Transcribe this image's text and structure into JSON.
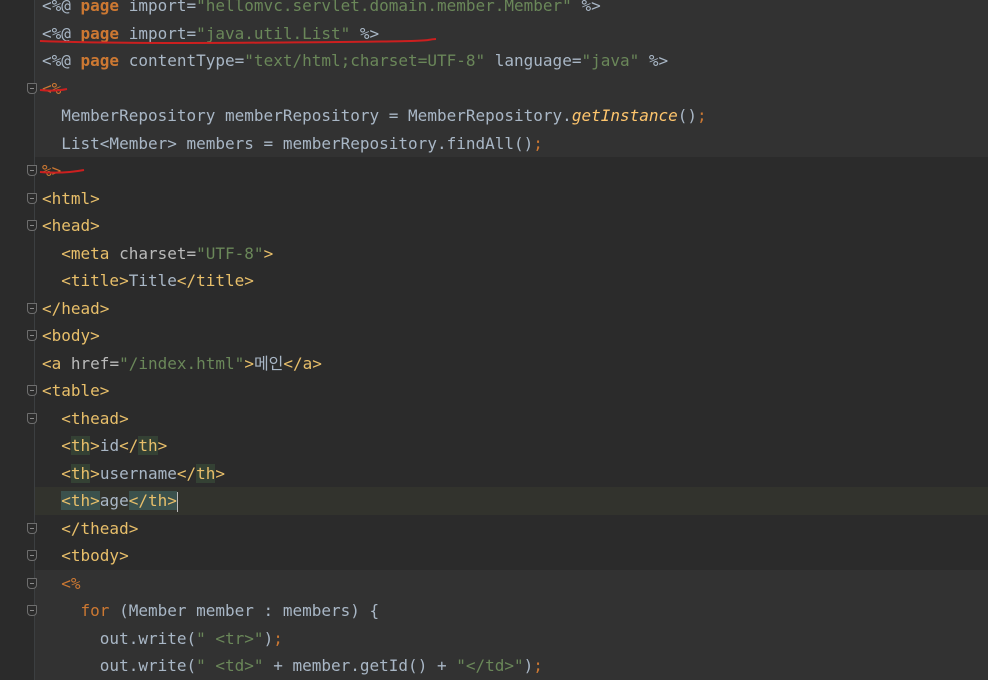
{
  "editor": {
    "lines": [
      {
        "segs": [
          [
            "t-txt",
            "<%@ "
          ],
          [
            "t-dir",
            "page"
          ],
          [
            "t-txt",
            " import="
          ],
          [
            "t-str",
            "\"hellomvc.servlet.domain.member.Member\""
          ],
          [
            "t-txt",
            " %>"
          ]
        ],
        "hl": true,
        "fold": ""
      },
      {
        "segs": [
          [
            "t-txt",
            "<%@ "
          ],
          [
            "t-dir",
            "page"
          ],
          [
            "t-txt",
            " import="
          ],
          [
            "t-str",
            "\"java.util.List\""
          ],
          [
            "t-txt",
            " %>"
          ]
        ],
        "hl": true,
        "fold": ""
      },
      {
        "segs": [
          [
            "t-txt",
            "<%@ "
          ],
          [
            "t-dir",
            "page"
          ],
          [
            "t-txt",
            " contentType="
          ],
          [
            "t-str",
            "\"text/html;charset=UTF-8\""
          ],
          [
            "t-txt",
            " language="
          ],
          [
            "t-str",
            "\"java\""
          ],
          [
            "t-txt",
            " %>"
          ]
        ],
        "hl": true,
        "fold": ""
      },
      {
        "segs": [
          [
            "t-kw",
            "<%"
          ]
        ],
        "hl": true,
        "fold": "start"
      },
      {
        "segs": [
          [
            "t-plain",
            "  MemberRepository memberRepository = MemberRepository."
          ],
          [
            "t-italic",
            "getInstance"
          ],
          [
            "t-plain",
            "()"
          ],
          [
            "t-semi",
            ";"
          ]
        ],
        "hl": true,
        "fold": ""
      },
      {
        "segs": [
          [
            "t-plain",
            "  List<Member> members = memberRepository.findAll()"
          ],
          [
            "t-semi",
            ";"
          ]
        ],
        "hl": true,
        "fold": ""
      },
      {
        "segs": [
          [
            "t-kw",
            "%>"
          ]
        ],
        "hl": false,
        "fold": "end"
      },
      {
        "segs": [
          [
            "t-tag",
            "<html>"
          ]
        ],
        "hl": false,
        "fold": "start"
      },
      {
        "segs": [
          [
            "t-tag",
            "<head>"
          ]
        ],
        "hl": false,
        "fold": "start"
      },
      {
        "segs": [
          [
            "t-txt",
            "  "
          ],
          [
            "t-tag",
            "<meta "
          ],
          [
            "t-attr",
            "charset="
          ],
          [
            "t-str",
            "\"UTF-8\""
          ],
          [
            "t-tag",
            ">"
          ]
        ],
        "hl": false,
        "fold": ""
      },
      {
        "segs": [
          [
            "t-txt",
            "  "
          ],
          [
            "t-tag",
            "<title>"
          ],
          [
            "t-txt",
            "Title"
          ],
          [
            "t-tag",
            "</title>"
          ]
        ],
        "hl": false,
        "fold": ""
      },
      {
        "segs": [
          [
            "t-tag",
            "</head>"
          ]
        ],
        "hl": false,
        "fold": "end"
      },
      {
        "segs": [
          [
            "t-tag",
            "<body>"
          ]
        ],
        "hl": false,
        "fold": "start"
      },
      {
        "segs": [
          [
            "t-tag",
            "<a "
          ],
          [
            "t-attr",
            "href="
          ],
          [
            "t-str",
            "\"/index.html\""
          ],
          [
            "t-tag",
            ">"
          ],
          [
            "t-txt",
            "메인"
          ],
          [
            "t-tag",
            "</a>"
          ]
        ],
        "hl": false,
        "fold": ""
      },
      {
        "segs": [
          [
            "t-tag",
            "<table>"
          ]
        ],
        "hl": false,
        "fold": "start"
      },
      {
        "segs": [
          [
            "t-txt",
            "  "
          ],
          [
            "t-tag",
            "<thead>"
          ]
        ],
        "hl": false,
        "fold": "start"
      },
      {
        "segs": [
          [
            "t-txt",
            "  "
          ],
          [
            "t-tag",
            "<"
          ],
          [
            "t-tag thbox",
            "th"
          ],
          [
            "t-tag",
            ">"
          ],
          [
            "t-txt",
            "id"
          ],
          [
            "t-tag",
            "</"
          ],
          [
            "t-tag thbox",
            "th"
          ],
          [
            "t-tag",
            ">"
          ]
        ],
        "hl": false,
        "fold": ""
      },
      {
        "segs": [
          [
            "t-txt",
            "  "
          ],
          [
            "t-tag",
            "<"
          ],
          [
            "t-tag thbox",
            "th"
          ],
          [
            "t-tag",
            ">"
          ],
          [
            "t-txt",
            "username"
          ],
          [
            "t-tag",
            "</"
          ],
          [
            "t-tag thbox",
            "th"
          ],
          [
            "t-tag",
            ">"
          ]
        ],
        "hl": false,
        "fold": ""
      },
      {
        "segs": [
          [
            "t-txt",
            "  "
          ],
          [
            "t-tag tagbox",
            "<th>"
          ],
          [
            "t-txt",
            "age"
          ],
          [
            "t-tag tagbox",
            "</th>"
          ]
        ],
        "hl": false,
        "fold": "",
        "caret": true
      },
      {
        "segs": [
          [
            "t-txt",
            "  "
          ],
          [
            "t-tag",
            "</thead>"
          ]
        ],
        "hl": false,
        "fold": "end"
      },
      {
        "segs": [
          [
            "t-txt",
            "  "
          ],
          [
            "t-tag",
            "<tbody>"
          ]
        ],
        "hl": false,
        "fold": "start"
      },
      {
        "segs": [
          [
            "t-txt",
            "  "
          ],
          [
            "t-kw",
            "<%"
          ]
        ],
        "hl": true,
        "fold": "start"
      },
      {
        "segs": [
          [
            "t-txt",
            "    "
          ],
          [
            "t-kw",
            "for "
          ],
          [
            "t-plain",
            "(Member member : members) {"
          ]
        ],
        "hl": true,
        "fold": "start"
      },
      {
        "segs": [
          [
            "t-txt",
            "      "
          ],
          [
            "t-plain",
            "out.write("
          ],
          [
            "t-str",
            "\" <tr>\""
          ],
          [
            "t-plain",
            ")"
          ],
          [
            "t-semi",
            ";"
          ]
        ],
        "hl": true,
        "fold": ""
      },
      {
        "segs": [
          [
            "t-txt",
            "      "
          ],
          [
            "t-plain",
            "out.write("
          ],
          [
            "t-str",
            "\" <td>\""
          ],
          [
            "t-plain",
            " + member.getId() + "
          ],
          [
            "t-str",
            "\"</td>\""
          ],
          [
            "t-plain",
            ")"
          ],
          [
            "t-semi",
            ";"
          ]
        ],
        "hl": true,
        "fold": ""
      }
    ]
  }
}
